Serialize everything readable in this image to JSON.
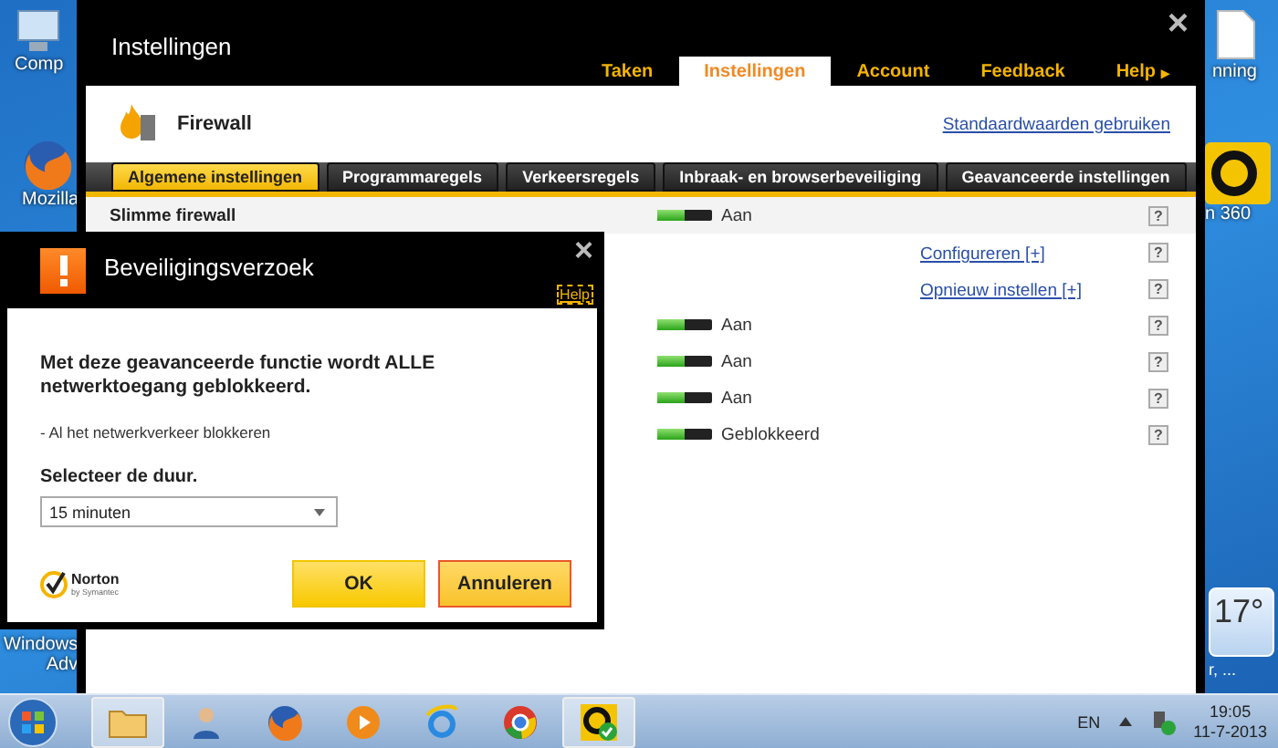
{
  "desktop": {
    "icons": [
      {
        "kind": "computer",
        "label": "Comp"
      },
      {
        "kind": "fox",
        "label": "Mozilla"
      },
      {
        "kind": "window",
        "label": "Windows",
        "label2": "Adv"
      },
      {
        "kind": "file",
        "label": "nning"
      },
      {
        "kind": "ring",
        "label": "n 360"
      }
    ],
    "gadget": {
      "temperature": "17°",
      "caption": "r, ..."
    }
  },
  "main_window": {
    "title": "Instellingen",
    "close": "×",
    "nav_tabs": [
      {
        "label": "Taken",
        "selected": false
      },
      {
        "label": "Instellingen",
        "selected": true
      },
      {
        "label": "Account",
        "selected": false
      },
      {
        "label": "Feedback",
        "selected": false
      },
      {
        "label": "Help",
        "selected": false,
        "caret": "▸"
      }
    ],
    "section": "Firewall",
    "defaults_link": "Standaardwaarden gebruiken",
    "sub_tabs": [
      {
        "label": "Algemene instellingen",
        "selected": true
      },
      {
        "label": "Programmaregels",
        "selected": false
      },
      {
        "label": "Verkeersregels",
        "selected": false
      },
      {
        "label": "Inbraak- en browserbeveiliging",
        "selected": false
      },
      {
        "label": "Geavanceerde instellingen",
        "selected": false
      }
    ],
    "rows": [
      {
        "kind": "toggle",
        "label": "Slimme firewall",
        "on": true,
        "status": "Aan",
        "help": "?"
      },
      {
        "kind": "link",
        "link": "Configureren [+]",
        "help": "?"
      },
      {
        "kind": "link",
        "link": "Opnieuw instellen [+]",
        "help": "?"
      },
      {
        "kind": "toggle",
        "on": true,
        "status": "Aan",
        "help": "?"
      },
      {
        "kind": "toggle",
        "on": true,
        "status": "Aan",
        "help": "?"
      },
      {
        "kind": "toggle",
        "on": true,
        "status": "Aan",
        "help": "?"
      },
      {
        "kind": "toggle",
        "on": true,
        "status": "Geblokkeerd",
        "help": "?"
      }
    ]
  },
  "dialog": {
    "title": "Beveiligingsverzoek",
    "close": "×",
    "help": "Help",
    "message": "Met deze geavanceerde functie wordt ALLE netwerktoegang geblokkeerd.",
    "detail": "- Al het netwerkverkeer blokkeren",
    "duration_label": "Selecteer de duur.",
    "duration_value": "15 minuten",
    "brand": "Norton",
    "brand_sub": "by Symantec",
    "buttons": [
      {
        "label": "OK",
        "focused": false
      },
      {
        "label": "Annuleren",
        "focused": true
      }
    ]
  },
  "taskbar": {
    "apps": [
      {
        "kind": "folder",
        "active": true
      },
      {
        "kind": "person",
        "active": false
      },
      {
        "kind": "fox",
        "active": false
      },
      {
        "kind": "play",
        "active": false
      },
      {
        "kind": "ie",
        "active": false
      },
      {
        "kind": "chrome",
        "active": false
      },
      {
        "kind": "norton",
        "active": true
      }
    ],
    "language": "EN",
    "time": "19:05",
    "date": "11-7-2013"
  }
}
